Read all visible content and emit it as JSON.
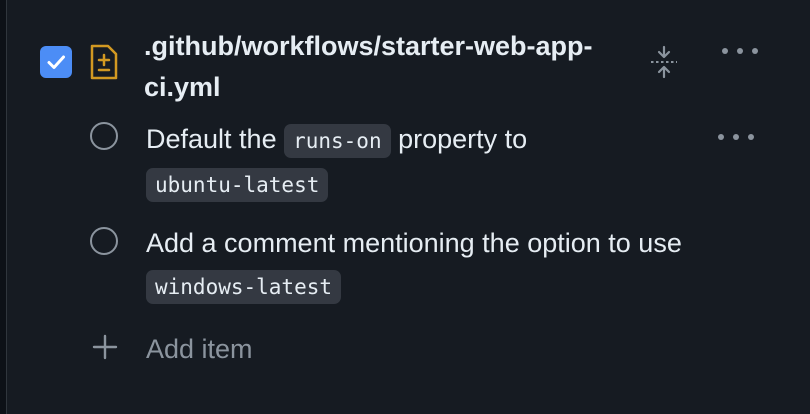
{
  "file": {
    "checked": true,
    "title": ".github/workflows/starter-web-app-ci.yml",
    "icon": "file-diff-icon"
  },
  "items": [
    {
      "before": "Default the ",
      "code1": "runs-on",
      "middle": " property to ",
      "code2": "ubuntu-latest"
    },
    {
      "before": "Add a comment mentioning the option to use ",
      "code1": "windows-latest"
    }
  ],
  "add_item_label": "Add item",
  "colors": {
    "checkbox": "#4c8df6",
    "file_icon": "#d29922",
    "code_bg": "#343942",
    "muted": "#8b949e"
  }
}
